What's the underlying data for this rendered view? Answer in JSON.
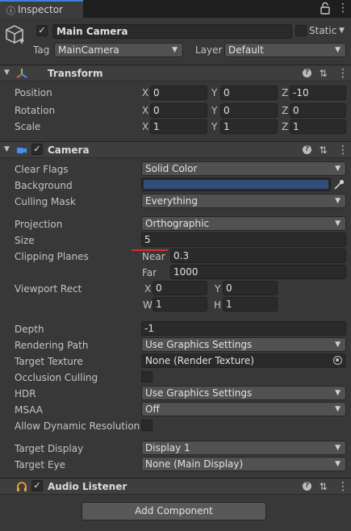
{
  "tab": {
    "label": "Inspector",
    "icon": "info-icon"
  },
  "object": {
    "active": true,
    "name": "Main Camera",
    "static_label": "Static",
    "static_checked": false
  },
  "tag": {
    "label": "Tag",
    "value": "MainCamera"
  },
  "layer": {
    "label": "Layer",
    "value": "Default"
  },
  "transform": {
    "title": "Transform",
    "position": {
      "label": "Position",
      "x": "0",
      "y": "0",
      "z": "-10"
    },
    "rotation": {
      "label": "Rotation",
      "x": "0",
      "y": "0",
      "z": "0"
    },
    "scale": {
      "label": "Scale",
      "x": "1",
      "y": "1",
      "z": "1"
    }
  },
  "axes": {
    "x": "X",
    "y": "Y",
    "z": "Z",
    "w": "W",
    "h": "H"
  },
  "camera": {
    "title": "Camera",
    "enabled": true,
    "clear_flags": {
      "label": "Clear Flags",
      "value": "Solid Color"
    },
    "background": {
      "label": "Background",
      "color": "#314d79"
    },
    "culling_mask": {
      "label": "Culling Mask",
      "value": "Everything"
    },
    "projection": {
      "label": "Projection",
      "value": "Orthographic"
    },
    "size": {
      "label": "Size",
      "value": "5"
    },
    "clipping": {
      "label": "Clipping Planes",
      "near_label": "Near",
      "near": "0.3",
      "far_label": "Far",
      "far": "1000"
    },
    "viewport": {
      "label": "Viewport Rect",
      "x": "0",
      "y": "0",
      "w": "1",
      "h": "1"
    },
    "depth": {
      "label": "Depth",
      "value": "-1"
    },
    "rendering_path": {
      "label": "Rendering Path",
      "value": "Use Graphics Settings"
    },
    "target_texture": {
      "label": "Target Texture",
      "value": "None (Render Texture)"
    },
    "occlusion": {
      "label": "Occlusion Culling",
      "checked": false
    },
    "hdr": {
      "label": "HDR",
      "value": "Use Graphics Settings"
    },
    "msaa": {
      "label": "MSAA",
      "value": "Off"
    },
    "dynamic_res": {
      "label": "Allow Dynamic Resolution",
      "checked": false
    },
    "target_display": {
      "label": "Target Display",
      "value": "Display 1"
    },
    "target_eye": {
      "label": "Target Eye",
      "value": "None (Main Display)"
    }
  },
  "audio_listener": {
    "title": "Audio Listener",
    "enabled": true
  },
  "add_component": "Add Component",
  "colors": {
    "accent": "#3d80df",
    "annotation": "#d62d2d"
  }
}
